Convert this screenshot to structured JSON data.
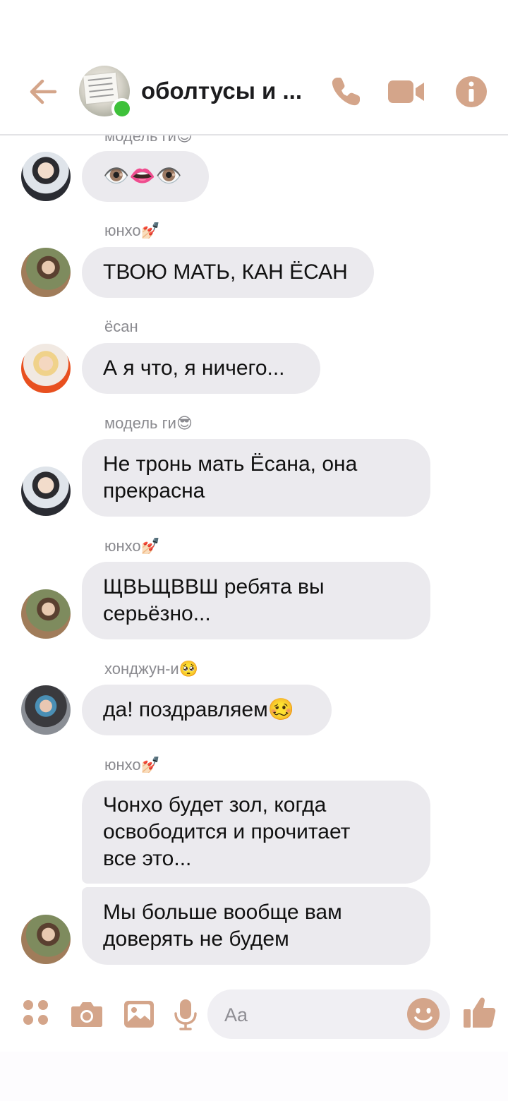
{
  "header": {
    "title": "оболтусы и ...",
    "accent_color": "#d4a58a",
    "online_color": "#3ec13a"
  },
  "messages": [
    {
      "sender": "модель ги😎",
      "text": "👁️👄👁️",
      "avatar": "gi"
    },
    {
      "sender": "юнхо💅🏻",
      "text": "ТВОЮ МАТЬ, КАН ЁСАН",
      "avatar": "yunho"
    },
    {
      "sender": "ёсан",
      "text": "А я что, я ничего...",
      "avatar": "yeosang"
    },
    {
      "sender": "модель ги😎",
      "text": "Не тронь мать Ёсана, она\nпрекрасна",
      "avatar": "gi"
    },
    {
      "sender": "юнхо💅🏻",
      "text": "ЩВЬЩВВШ ребята вы\nсерьёзно...",
      "avatar": "yunho"
    },
    {
      "sender": "хонджун-и🥺",
      "text": "да! поздравляем🥴",
      "avatar": "hongjoong"
    },
    {
      "sender": "юнхо💅🏻",
      "text": "Чонхо будет зол, когда\nосвободится и прочитает\nвсе это...",
      "avatar": null
    },
    {
      "sender": null,
      "text": "Мы больше вообще вам\nдоверять не будем",
      "avatar": "yunho"
    }
  ],
  "composer": {
    "placeholder": "Aa"
  },
  "icons": {
    "back": "back-arrow-icon",
    "call": "phone-icon",
    "video": "video-camera-icon",
    "info": "info-icon",
    "apps": "apps-grid-icon",
    "camera": "camera-icon",
    "gallery": "image-icon",
    "mic": "microphone-icon",
    "emoji": "smiley-icon",
    "like": "thumbs-up-icon"
  }
}
